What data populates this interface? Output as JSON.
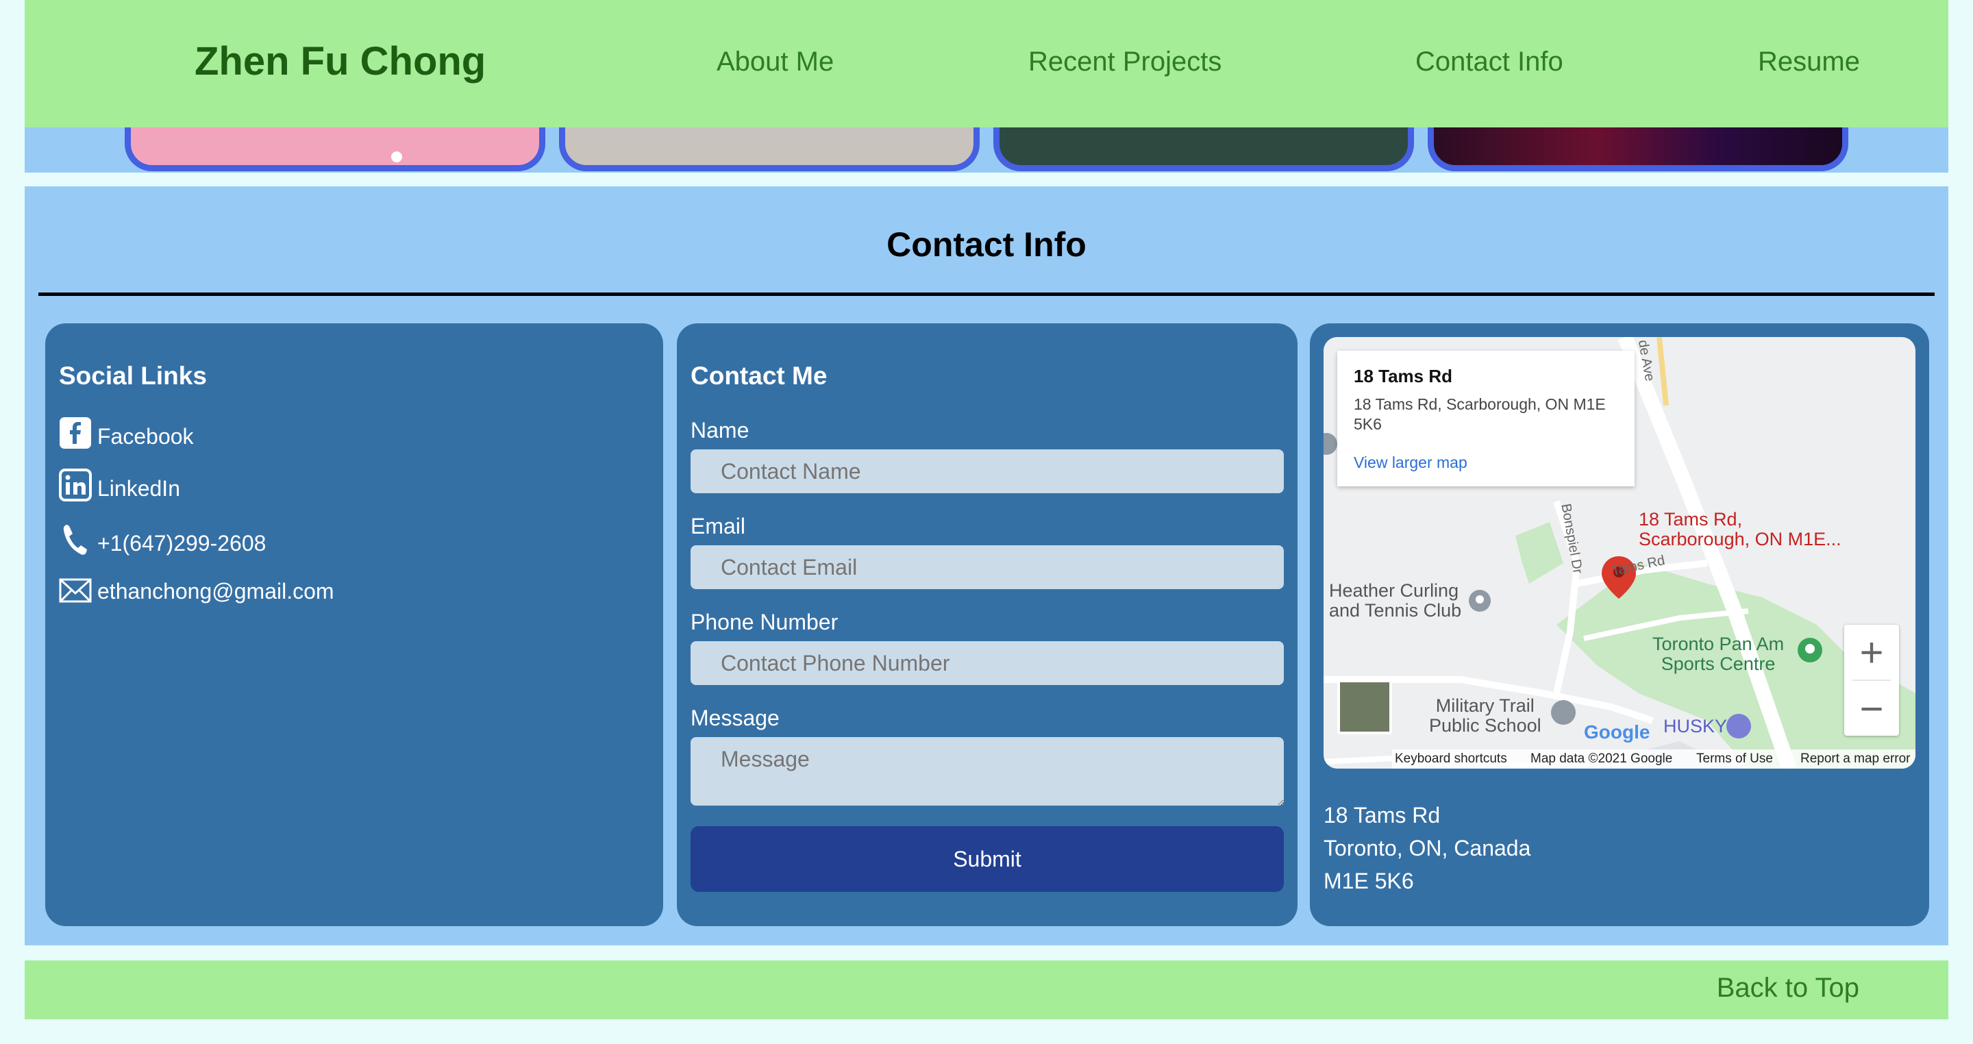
{
  "header": {
    "logo": "Zhen Fu Chong",
    "nav": [
      "About Me",
      "Recent Projects",
      "Contact Info",
      "Resume"
    ]
  },
  "contact": {
    "title": "Contact Info",
    "social": {
      "heading": "Social Links",
      "items": [
        {
          "icon": "facebook-icon",
          "label": "Facebook"
        },
        {
          "icon": "linkedin-icon",
          "label": "LinkedIn"
        },
        {
          "icon": "phone-icon",
          "label": "+1(647)299-2608"
        },
        {
          "icon": "mail-icon",
          "label": "ethanchong@gmail.com"
        }
      ]
    },
    "form": {
      "heading": "Contact Me",
      "name_label": "Name",
      "name_placeholder": "Contact Name",
      "email_label": "Email",
      "email_placeholder": "Contact Email",
      "phone_label": "Phone Number",
      "phone_placeholder": "Contact Phone Number",
      "message_label": "Message",
      "message_placeholder": "Message",
      "submit": "Submit"
    },
    "map": {
      "card_title": "18 Tams Rd",
      "card_address": "18 Tams Rd, Scarborough, ON M1E 5K6",
      "card_link": "View larger map",
      "pin_label_1": "18 Tams Rd,",
      "pin_label_2": "Scarborough, ON M1E...",
      "poi_curling_1": "Heather Curling",
      "poi_curling_2": "and Tennis Club",
      "poi_panam_1": "Toronto Pan Am",
      "poi_panam_2": "Sports Centre",
      "poi_school_1": "Military Trail",
      "poi_school_2": "Public School",
      "poi_husky": "HUSKY",
      "street_tams": "Tams Rd",
      "street_bonspiel": "Bonspiel Dr",
      "street_ave": "de Ave",
      "google": "Google",
      "footer": [
        "Keyboard shortcuts",
        "Map data ©2021 Google",
        "Terms of Use",
        "Report a map error"
      ],
      "zoom_in": "+",
      "zoom_out": "−"
    },
    "address": [
      "18 Tams Rd",
      "Toronto, ON, Canada",
      "M1E 5K6"
    ]
  },
  "footer": {
    "back_to_top": "Back to Top"
  },
  "colors": {
    "header_bg": "#a6ed98",
    "section_bg": "#97cbf5",
    "panel_bg": "#3570a5",
    "submit_bg": "#223f92",
    "nav_text": "#2e7d22"
  }
}
